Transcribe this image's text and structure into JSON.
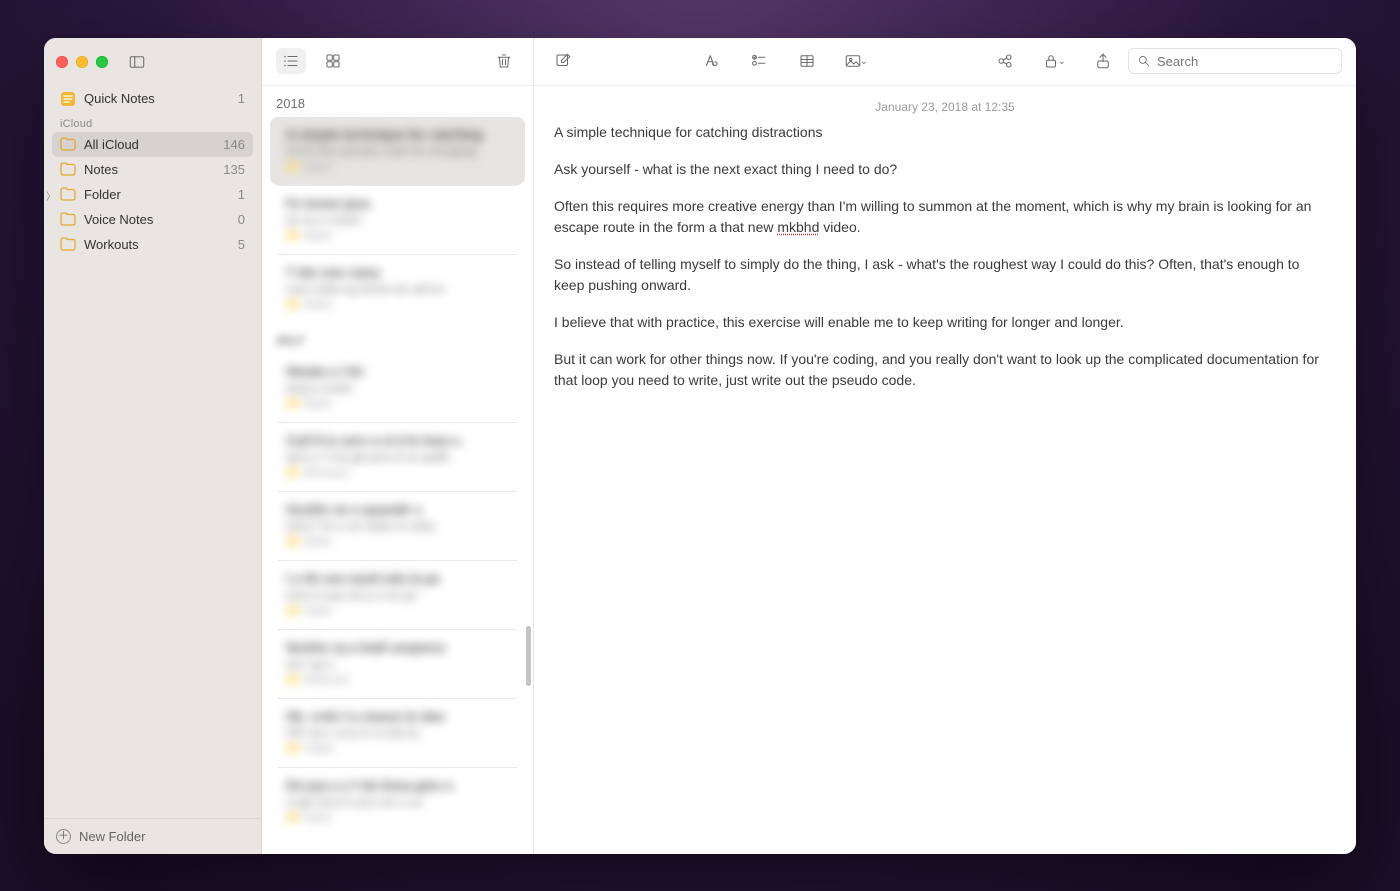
{
  "sidebar": {
    "quick_notes": {
      "label": "Quick Notes",
      "count": "1"
    },
    "section_icloud": "iCloud",
    "folders": [
      {
        "label": "All iCloud",
        "count": "146",
        "active": true,
        "collapsible": false
      },
      {
        "label": "Notes",
        "count": "135",
        "active": false,
        "collapsible": false
      },
      {
        "label": "Folder",
        "count": "1",
        "active": false,
        "collapsible": true
      },
      {
        "label": "Voice Notes",
        "count": "0",
        "active": false,
        "collapsible": false
      },
      {
        "label": "Workouts",
        "count": "5",
        "active": false,
        "collapsible": false
      }
    ],
    "new_folder_label": "New Folder"
  },
  "notes_list": {
    "year_header_1": "2018",
    "year_header_2": "2017"
  },
  "editor": {
    "search_placeholder": "Search",
    "date": "January 23, 2018 at 12:35",
    "title": "A simple technique for catching distractions",
    "p1": "Ask yourself - what is the next exact thing I need to do?",
    "p2a": "Often this requires more creative energy than I'm willing to summon at the moment, which is why my brain is looking for an escape route in the form a that new ",
    "p2_mis": "mkbhd",
    "p2b": " video.",
    "p3": "So instead of telling myself to simply do the thing, I ask - what's the roughest way I could do this? Often, that's enough to keep pushing onward.",
    "p4": "I believe that with practice, this exercise will enable me to keep writing for longer and longer.",
    "p5": "But it can work for other things now. If you're coding, and you really don't want to look up the complicated documentation for that loop you need to write, just write out the pseudo code."
  }
}
